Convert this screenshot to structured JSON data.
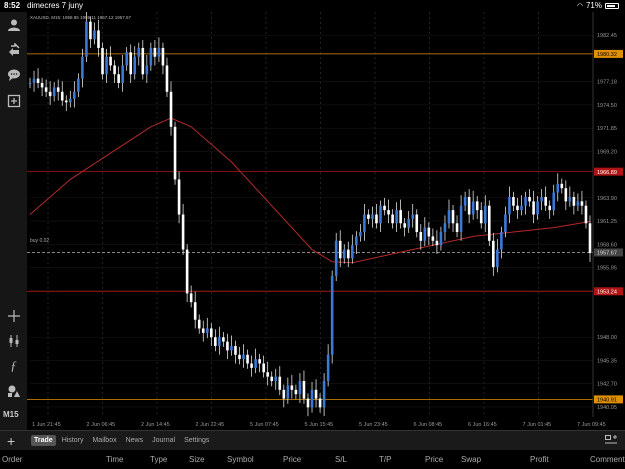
{
  "status_bar": {
    "time": "8:52",
    "date": "dimecres 7 juny",
    "battery": "71%"
  },
  "chart_title": "XAUUSD, M15: 1958.85 1959.11 1957.12 1957.67",
  "trade_label": "buy 0.02",
  "price_axis": [
    "1982.45",
    "1977.18",
    "1974.50",
    "1971.85",
    "1969.20",
    "1963.90",
    "1961.25",
    "1958.60",
    "1955.95",
    "1953.30",
    "1948.00",
    "1945.35",
    "1942.70",
    "1940.05"
  ],
  "price_tags": [
    {
      "text": "1980.32",
      "bg": "#e08f00",
      "fg": "#000000"
    },
    {
      "text": "1966.89",
      "bg": "#b01414",
      "fg": "#ffffff"
    },
    {
      "text": "1957.67",
      "bg": "#444444",
      "fg": "#dddddd"
    },
    {
      "text": "1953.24",
      "bg": "#b01414",
      "fg": "#ffffff"
    },
    {
      "text": "1940.91",
      "bg": "#e08f00",
      "fg": "#000000"
    }
  ],
  "time_axis": [
    "1 Jun 21:45",
    "2 Jun 06:45",
    "2 Jun 14:45",
    "2 Jun 22:45",
    "5 Jun 07:45",
    "5 Jun 15:45",
    "5 Jun 23:45",
    "6 Jun 08:45",
    "6 Jun 16:45",
    "7 Jun 01:45",
    "7 Jun 09:45"
  ],
  "sidebar": {
    "timeframe": "M15",
    "icons": [
      "account-icon",
      "trade-arrows-icon",
      "chat-icon",
      "new-chart-icon",
      "crosshair-icon",
      "indicators-icon",
      "function-icon",
      "objects-icon"
    ]
  },
  "bottom_tabs": [
    "Trade",
    "History",
    "Mailbox",
    "News",
    "Journal",
    "Settings"
  ],
  "active_tab": "Trade",
  "columns": [
    "Order",
    "Time",
    "Type",
    "Size",
    "Symbol",
    "Price",
    "S/L",
    "T/P",
    "Price",
    "Swap",
    "Profit",
    "Comment"
  ],
  "colors": {
    "candle": "#3b78d8",
    "wick": "#ffffff",
    "ma": "#b52a2a",
    "level_orange": "#e08f00",
    "level_red": "#b01414"
  },
  "chart_data": {
    "type": "line",
    "series": [
      {
        "role": "close",
        "x_index": [
          0,
          4,
          8,
          12,
          16,
          20,
          24,
          28,
          32,
          36,
          40,
          44,
          48,
          52,
          56,
          60,
          64,
          68,
          72,
          76,
          80,
          84,
          88,
          92,
          96,
          100,
          104,
          108,
          112,
          116,
          120,
          124,
          128,
          132,
          136,
          140,
          144,
          148,
          152,
          156,
          160,
          164,
          168,
          172,
          176,
          180,
          184,
          188,
          192,
          196,
          200,
          204,
          208,
          212,
          216,
          220,
          224,
          228,
          232,
          236,
          240,
          244,
          248,
          252,
          256,
          260,
          264,
          268,
          272,
          276,
          280,
          284,
          288,
          292,
          296,
          300,
          304,
          308,
          312,
          316,
          320,
          324,
          328,
          332,
          336,
          340,
          344,
          348,
          352,
          356,
          360,
          364,
          368,
          372,
          376,
          380,
          384,
          388,
          392,
          396,
          400,
          404,
          408,
          412,
          416,
          420,
          424,
          428,
          432,
          436,
          440,
          444,
          448,
          452,
          456,
          460,
          464,
          468,
          472,
          476,
          480,
          484,
          488,
          492,
          496,
          500,
          504,
          508,
          512,
          516,
          520,
          524,
          528,
          532,
          536,
          540,
          544,
          548,
          552,
          556
        ],
        "values": [
          1977.0,
          1977.5,
          1977.0,
          1976.5,
          1976.0,
          1975.5,
          1976.5,
          1976.0,
          1975.0,
          1974.8,
          1975.2,
          1976.0,
          1977.5,
          1980.0,
          1984.0,
          1982.0,
          1983.0,
          1981.0,
          1978.0,
          1980.0,
          1979.0,
          1978.0,
          1977.0,
          1979.0,
          1980.5,
          1978.0,
          1980.0,
          1981.0,
          1978.0,
          1979.0,
          1981.0,
          1980.0,
          1981.0,
          1979.0,
          1976.0,
          1972.0,
          1966.0,
          1962.0,
          1958.0,
          1953.0,
          1952.0,
          1950.0,
          1949.0,
          1948.5,
          1949.0,
          1948.0,
          1947.0,
          1948.0,
          1947.5,
          1946.5,
          1947.0,
          1946.0,
          1945.5,
          1946.0,
          1945.0,
          1944.5,
          1945.5,
          1945.0,
          1944.0,
          1943.5,
          1943.0,
          1943.5,
          1942.0,
          1941.0,
          1942.5,
          1942.0,
          1941.5,
          1943.0,
          1941.0,
          1940.0,
          1942.0,
          1941.0,
          1940.0,
          1943.0,
          1946.0,
          1955.0,
          1959.0,
          1957.0,
          1958.0,
          1957.0,
          1958.5,
          1959.5,
          1960.0,
          1962.0,
          1961.5,
          1962.0,
          1961.0,
          1963.0,
          1962.5,
          1962.0,
          1961.0,
          1962.5,
          1961.0,
          1960.5,
          1961.5,
          1962.0,
          1960.0,
          1959.0,
          1960.5,
          1959.5,
          1959.0,
          1958.5,
          1960.0,
          1961.0,
          1962.5,
          1961.0,
          1960.0,
          1963.0,
          1964.0,
          1962.0,
          1963.5,
          1962.5,
          1961.0,
          1963.0,
          1959.0,
          1956.0,
          1958.0,
          1960.0,
          1962.0,
          1964.0,
          1963.0,
          1962.5,
          1963.0,
          1964.0,
          1963.5,
          1962.0,
          1963.5,
          1964.0,
          1963.0,
          1962.5,
          1964.5,
          1965.5,
          1965.0,
          1963.5,
          1964.0,
          1963.0,
          1963.5,
          1963.0,
          1961.0,
          1957.6
        ]
      },
      {
        "role": "moving-average",
        "x_index": [
          0,
          40,
          80,
          120,
          140,
          160,
          200,
          240,
          280,
          300,
          320,
          360,
          400,
          440,
          480,
          520,
          556
        ],
        "values": [
          1962.0,
          1966.0,
          1969.0,
          1972.0,
          1973.0,
          1972.0,
          1968.0,
          1963.0,
          1958.0,
          1956.6,
          1956.5,
          1957.5,
          1958.5,
          1959.5,
          1960.0,
          1960.5,
          1961.2
        ]
      }
    ],
    "levels": [
      1980.32,
      1966.89,
      1957.67,
      1953.24,
      1940.91
    ],
    "ylim": [
      1938.9,
      1985.1
    ]
  }
}
